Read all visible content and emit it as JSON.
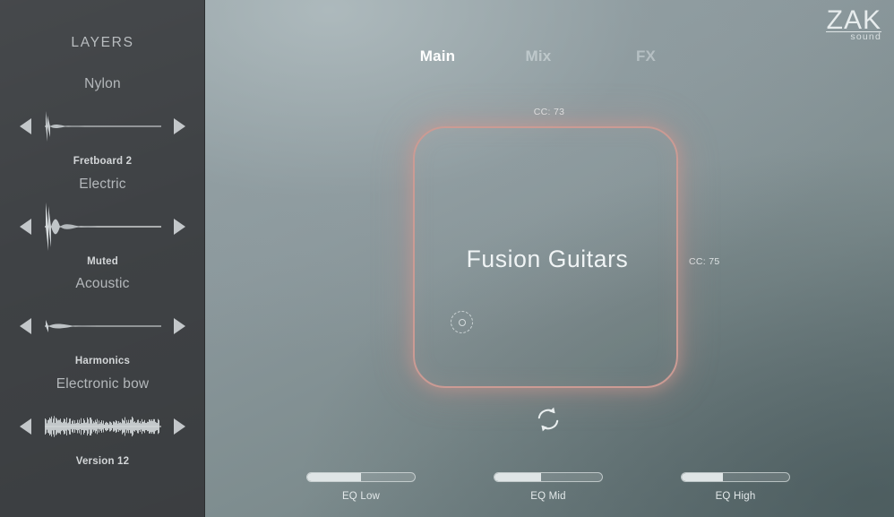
{
  "app": {
    "title": "Fusion Guitars",
    "brand_name": "ZAK",
    "brand_sub": "sound",
    "accent_color": "#cb9b94",
    "sidebar_bg": "#3f4245",
    "panel_bg": "#8a979b"
  },
  "sidebar": {
    "title": "LAYERS",
    "prev_icon": "triangle-left-icon",
    "next_icon": "triangle-right-icon",
    "layers": [
      {
        "name": "Nylon",
        "sample": "Fretboard 2",
        "waveform": "pluck-short"
      },
      {
        "name": "Electric",
        "sample": "Muted",
        "waveform": "pluck-tall"
      },
      {
        "name": "Acoustic",
        "sample": "Harmonics",
        "waveform": "pluck-soft"
      },
      {
        "name": "Electronic bow",
        "sample": "Version 12",
        "waveform": "sustain-dense"
      }
    ]
  },
  "tabs": [
    {
      "id": "main",
      "label": "Main",
      "active": true
    },
    {
      "id": "mix",
      "label": "Mix",
      "active": false
    },
    {
      "id": "fx",
      "label": "FX",
      "active": false
    }
  ],
  "pad": {
    "title": "Fusion Guitars",
    "cc_top": "CC: 73",
    "cc_right": "CC: 75",
    "knob_icon": "dashed-knob-icon"
  },
  "transport": {
    "refresh_icon": "refresh-cycle-icon"
  },
  "eq": [
    {
      "id": "low",
      "label": "EQ Low",
      "value": 50
    },
    {
      "id": "mid",
      "label": "EQ Mid",
      "value": 43
    },
    {
      "id": "high",
      "label": "EQ High",
      "value": 38
    }
  ]
}
